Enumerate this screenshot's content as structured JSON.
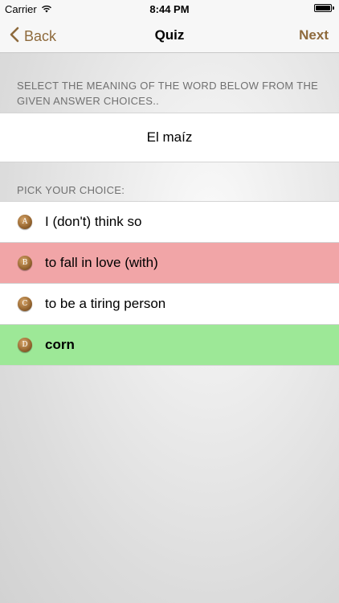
{
  "status_bar": {
    "carrier": "Carrier",
    "time": "8:44 PM",
    "wifi_icon": "wifi-icon",
    "battery_icon": "battery-icon"
  },
  "nav": {
    "back_label": "Back",
    "title": "Quiz",
    "next_label": "Next",
    "accent_color": "#8e6a3c"
  },
  "instruction": "SELECT THE MEANING OF THE WORD BELOW FROM THE GIVEN ANSWER CHOICES..",
  "word": "El maíz",
  "pick_label": "PICK YOUR CHOICE:",
  "choices": [
    {
      "letter": "A",
      "text": "I (don't) think so",
      "state": "neutral"
    },
    {
      "letter": "B",
      "text": "to fall in love (with)",
      "state": "wrong"
    },
    {
      "letter": "C",
      "text": "to be a tiring person",
      "state": "neutral"
    },
    {
      "letter": "D",
      "text": "corn",
      "state": "correct"
    }
  ],
  "colors": {
    "wrong": "#f1a5a7",
    "correct": "#9de897"
  }
}
